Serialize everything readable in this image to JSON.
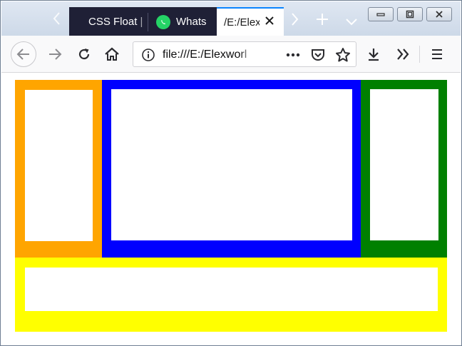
{
  "tabs": [
    {
      "label": "CSS Float |",
      "active": false
    },
    {
      "label": "Whats",
      "active": false
    },
    {
      "label": "/E:/Elex",
      "active": true
    }
  ],
  "toolbar": {
    "url": "file:///E:/Elexworl"
  },
  "icons": {
    "tab_scroll_left": "chevron-left-icon",
    "tab_scroll_right": "chevron-right-icon",
    "new_tab": "plus-icon",
    "tab_list": "chevron-down-icon",
    "whatsapp": "whatsapp-icon",
    "back": "arrow-left-icon",
    "forward": "arrow-right-icon",
    "reload": "reload-icon",
    "home": "home-icon",
    "site_info": "info-icon",
    "page_actions": "more-dots-icon",
    "pocket": "pocket-icon",
    "bookmark": "star-icon",
    "downloads": "download-icon",
    "overflow": "double-chevron-icon",
    "menu": "hamburger-icon"
  },
  "colors": {
    "tab_strip_dark": "#1f2036",
    "active_tab_accent": "#0a84ff",
    "box_orange": "#ffa500",
    "box_blue": "#0000ff",
    "box_green": "#008000",
    "box_yellow": "#ffff00"
  },
  "page": {
    "boxes": [
      {
        "name": "orange-box",
        "color": "orange"
      },
      {
        "name": "blue-box",
        "color": "blue"
      },
      {
        "name": "green-box",
        "color": "green"
      },
      {
        "name": "yellow-box",
        "color": "yellow"
      }
    ]
  }
}
